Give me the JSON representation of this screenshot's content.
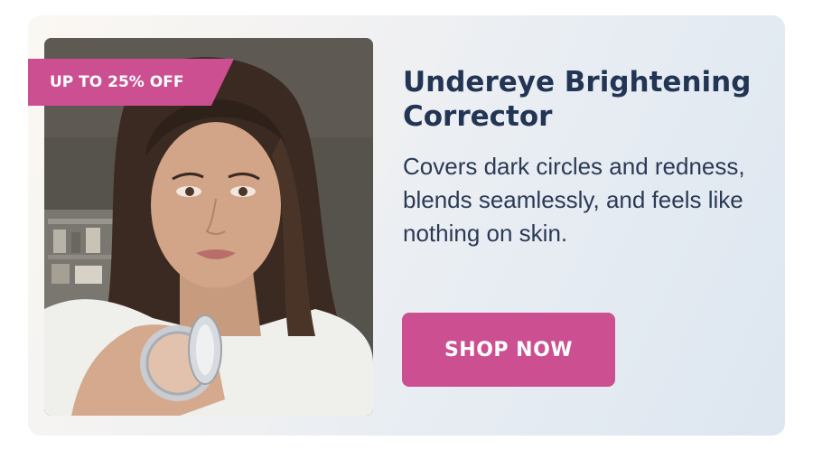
{
  "promo": {
    "badge_label": "UP TO 25% OFF",
    "title": "Undereye Brightening Corrector",
    "description": "Covers dark circles and redness, blends seamlessly, and feels like nothing on skin.",
    "cta_label": "SHOP NOW"
  },
  "colors": {
    "accent": "#cb4f91",
    "title_text": "#233554",
    "body_text": "#2b3a55"
  },
  "image": {
    "subject": "woman holding open compact corrector"
  }
}
